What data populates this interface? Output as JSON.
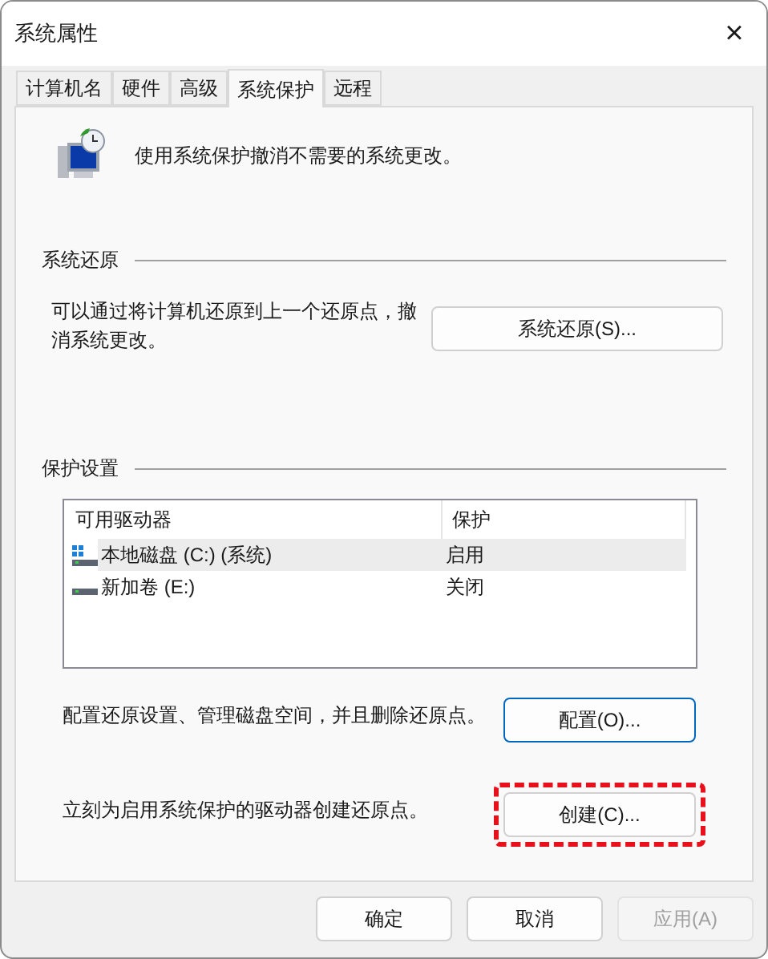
{
  "window": {
    "title": "系统属性",
    "close": "×"
  },
  "tabs": [
    {
      "label": "计算机名",
      "selected": false
    },
    {
      "label": "硬件",
      "selected": false
    },
    {
      "label": "高级",
      "selected": false
    },
    {
      "label": "系统保护",
      "selected": true
    },
    {
      "label": "远程",
      "selected": false
    }
  ],
  "intro": "使用系统保护撤消不需要的系统更改。",
  "restore": {
    "heading": "系统还原",
    "description": "可以通过将计算机还原到上一个还原点，撤消系统更改。",
    "button": {
      "label": "系统还原(S)...",
      "focused": false,
      "highlighted": false
    }
  },
  "protection": {
    "heading": "保护设置",
    "columns": [
      "可用驱动器",
      "保护"
    ],
    "rows": [
      {
        "kind": "system",
        "drive": "本地磁盘 (C:) (系统)",
        "protection": "启用",
        "selected": true
      },
      {
        "kind": "plain",
        "drive": "新加卷 (E:)",
        "protection": "关闭",
        "selected": false
      }
    ],
    "actions": [
      {
        "description": "配置还原设置、管理磁盘空间，并且删除还原点。",
        "button": {
          "label": "配置(O)...",
          "focused": true,
          "highlighted": false
        }
      },
      {
        "description": "立刻为启用系统保护的驱动器创建还原点。",
        "button": {
          "label": "创建(C)...",
          "focused": false,
          "highlighted": true
        }
      }
    ]
  },
  "buttons": [
    {
      "label": "确定",
      "disabled": false
    },
    {
      "label": "取消",
      "disabled": false
    },
    {
      "label": "应用(A)",
      "disabled": true
    }
  ]
}
